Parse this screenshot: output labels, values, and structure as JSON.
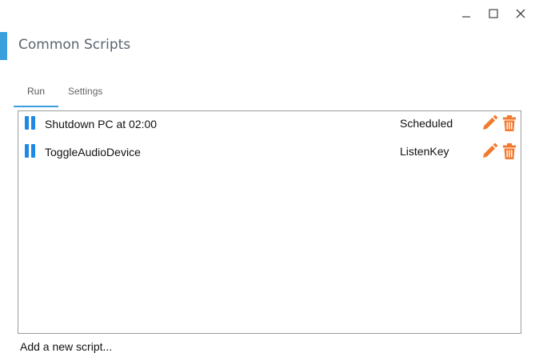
{
  "window": {
    "title": "Common Scripts",
    "accent_color": "#3aa0dc",
    "controls": [
      "minimize-icon",
      "maximize-icon",
      "close-icon"
    ]
  },
  "tabs": [
    {
      "label": "Run",
      "active": true
    },
    {
      "label": "Settings",
      "active": false
    }
  ],
  "scripts": [
    {
      "name": "Shutdown PC at 02:00",
      "trigger": "Scheduled",
      "status_icon": "pause-icon",
      "actions": [
        "pencil-icon",
        "trash-icon"
      ]
    },
    {
      "name": "ToggleAudioDevice",
      "trigger": "ListenKey",
      "status_icon": "pause-icon",
      "actions": [
        "pencil-icon",
        "trash-icon"
      ]
    }
  ],
  "colors": {
    "pause": "#1e88e5",
    "action": "#f07a2f"
  },
  "footer": {
    "add_label": "Add a new script..."
  }
}
